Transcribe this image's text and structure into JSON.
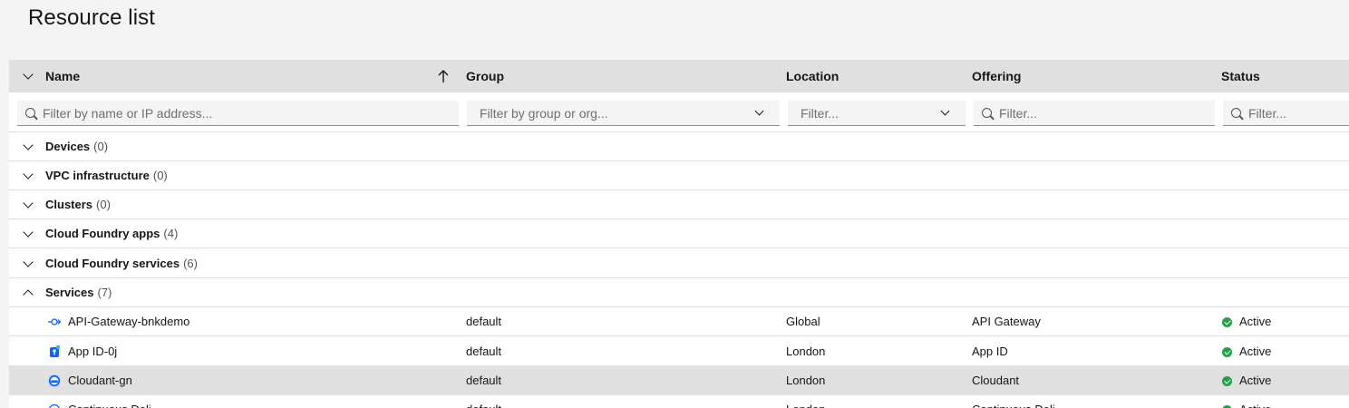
{
  "page": {
    "title": "Resource list"
  },
  "columns": {
    "name": "Name",
    "group": "Group",
    "location": "Location",
    "offering": "Offering",
    "status": "Status"
  },
  "filters": {
    "name_placeholder": "Filter by name or IP address...",
    "group_placeholder": "Filter by group or org...",
    "location_placeholder": "Filter...",
    "offering_placeholder": "Filter...",
    "status_placeholder": "Filter..."
  },
  "groups": [
    {
      "label": "Devices",
      "count": "(0)",
      "expanded": false
    },
    {
      "label": "VPC infrastructure",
      "count": "(0)",
      "expanded": false
    },
    {
      "label": "Clusters",
      "count": "(0)",
      "expanded": false
    },
    {
      "label": "Cloud Foundry apps",
      "count": "(4)",
      "expanded": false
    },
    {
      "label": "Cloud Foundry services",
      "count": "(6)",
      "expanded": false
    },
    {
      "label": "Services",
      "count": "(7)",
      "expanded": true
    }
  ],
  "services": [
    {
      "name": "API-Gateway-bnkdemo",
      "group": "default",
      "location": "Global",
      "offering": "API Gateway",
      "status": "Active",
      "icon": "api-gateway-icon"
    },
    {
      "name": "App ID-0j",
      "group": "default",
      "location": "London",
      "offering": "App ID",
      "status": "Active",
      "icon": "app-id-icon"
    },
    {
      "name": "Cloudant-gn",
      "group": "default",
      "location": "London",
      "offering": "Cloudant",
      "status": "Active",
      "icon": "cloudant-icon"
    },
    {
      "name": "Continuous Deli...",
      "group": "default",
      "location": "London",
      "offering": "Continuous Deli...",
      "status": "Active",
      "icon": "continuous-delivery-icon"
    }
  ],
  "colors": {
    "active": "#24a148",
    "header_bg": "#e0e0e0",
    "accent": "#0f62fe"
  }
}
